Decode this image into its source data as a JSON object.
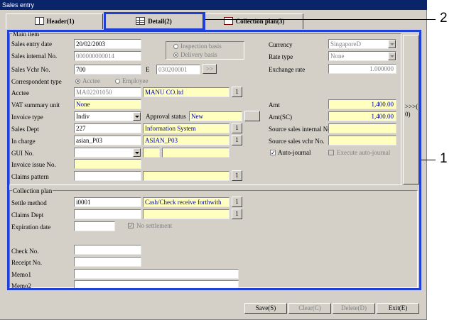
{
  "window": {
    "title": "Sales entry"
  },
  "tabs": {
    "header": "Header(1)",
    "detail": "Detail(2)",
    "collection": "Collection plan(3)"
  },
  "main_item": {
    "group_title": "Main item",
    "sales_entry_date": {
      "label": "Sales entry date",
      "value": "20/02/2003"
    },
    "sales_internal_no": {
      "label": "Sales internal No.",
      "value": "000000000014"
    },
    "sales_vchr_no": {
      "label": "Sales Vchr No.",
      "value": "700",
      "e_label": "E",
      "e_value": "030200001",
      "btn": ">>"
    },
    "basis": {
      "inspection": "Inspection basis",
      "delivery": "Delivery basis"
    },
    "currency": {
      "label": "Currency",
      "value": "SingaporeD"
    },
    "rate_type": {
      "label": "Rate type",
      "value": "None"
    },
    "exchange_rate": {
      "label": "Exchange rate",
      "value": "1.000000"
    },
    "correspondent_type": {
      "label": "Correspondent type",
      "acctee": "Acctee",
      "employee": "Employee"
    },
    "acctee": {
      "label": "Acctee",
      "code": "MA02201050",
      "name": "MANU CO.ltd",
      "btn": "1"
    },
    "vat_summary_unit": {
      "label": "VAT summary unit",
      "value": "None"
    },
    "invoice_type": {
      "label": "Invoice type",
      "value": "Indiv"
    },
    "approval_status": {
      "label": "Approval status",
      "value": "New"
    },
    "sales_dept": {
      "label": "Sales Dept",
      "code": "227",
      "name": "Information System",
      "btn": "1"
    },
    "in_charge": {
      "label": "In charge",
      "code": "asian_P03",
      "name": "ASIAN_P03",
      "btn": "1"
    },
    "gui_no": {
      "label": "GUI No."
    },
    "invoice_issue_no": {
      "label": "Invoice issue No."
    },
    "claims_pattern": {
      "label": "Claims pattern",
      "btn": "1"
    },
    "amt": {
      "label": "Amt",
      "value": "1,400.00"
    },
    "amt_sc": {
      "label": "Amt(SC)",
      "value": "1,400.00"
    },
    "source_internal_no": {
      "label": "Source sales internal No."
    },
    "source_vchr_no": {
      "label": "Source sales vchr No."
    },
    "auto_journal": {
      "label": "Auto-journal",
      "mark": "✓"
    },
    "execute_auto_journal": {
      "label": "Execute auto-journal"
    },
    "side_button": {
      "line1": ">>>(",
      "line2": "0)"
    }
  },
  "collection_plan": {
    "group_title": "Collection plan",
    "settle_method": {
      "label": "Settle method",
      "code": "i0001",
      "name": "Cash/Check receive forthwith",
      "btn": "1"
    },
    "claims_dept": {
      "label": "Claims Dept",
      "btn": "1"
    },
    "expiration_date": {
      "label": "Expiration date"
    },
    "no_settlement": {
      "label": "No settlement",
      "mark": "✓"
    },
    "check_no": {
      "label": "Check No."
    },
    "receipt_no": {
      "label": "Receipt No."
    },
    "memo1": {
      "label": "Memo1"
    },
    "memo2": {
      "label": "Memo2"
    }
  },
  "footer": {
    "save": "Save(S)",
    "clear": "Clear(C)",
    "delete": "Delete(D)",
    "exit": "Exit(E)"
  },
  "callouts": {
    "one": "1",
    "two": "2"
  },
  "colors": {
    "callout": "#1f3fd6",
    "titlebar": "#0a246a",
    "required": "#ffffc0"
  }
}
